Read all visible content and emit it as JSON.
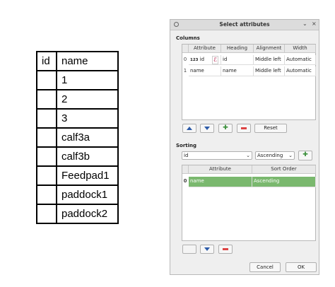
{
  "table": {
    "header": {
      "id": "id",
      "name": "name"
    },
    "rows": [
      "1",
      "2",
      "3",
      "calf3a",
      "calf3b",
      "Feedpad1",
      "paddock1",
      "paddock2"
    ]
  },
  "dialog": {
    "title": "Select attributes",
    "columns_label": "Columns",
    "columns_headers": [
      "Attribute",
      "Heading",
      "Alignment",
      "Width"
    ],
    "columns_rows": [
      {
        "num": "0",
        "type": "123",
        "attribute": "id",
        "expr": "ℰ",
        "heading": "id",
        "alignment": "Middle left",
        "width": "Automatic"
      },
      {
        "num": "1",
        "attribute": "name",
        "heading": "name",
        "alignment": "Middle left",
        "width": "Automatic"
      }
    ],
    "reset_label": "Reset",
    "sorting_label": "Sorting",
    "sort_field": "id",
    "sort_order": "Ascending",
    "sorting_headers": [
      "Attribute",
      "Sort Order"
    ],
    "sorting_rows": [
      {
        "num": "0",
        "attribute": "name",
        "order": "Ascending"
      }
    ],
    "cancel_label": "Cancel",
    "ok_label": "OK",
    "colors": {
      "selected_row": "#7ab86e",
      "arrow": "#2c5aa8",
      "add": "#3a8f3a",
      "remove": "#d44444"
    }
  }
}
